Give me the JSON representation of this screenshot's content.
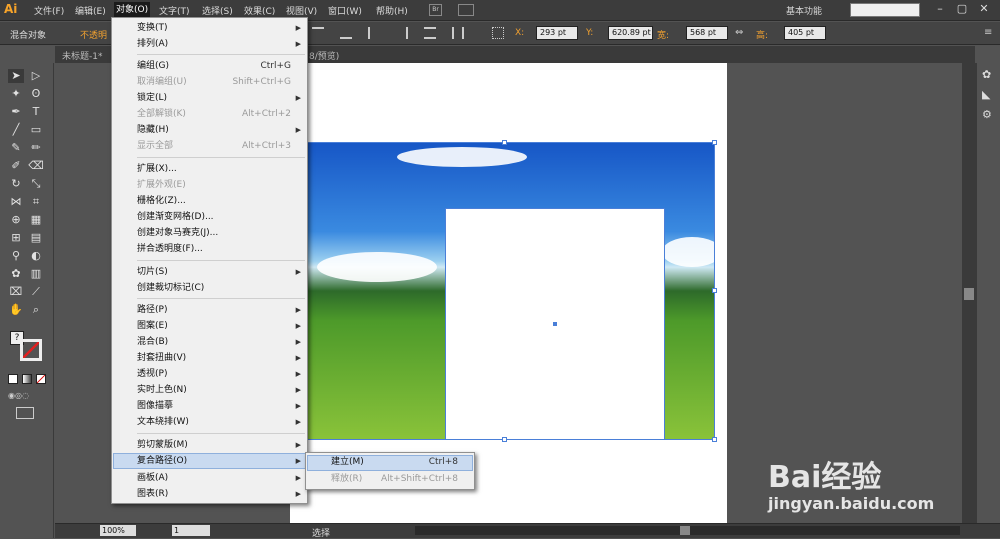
{
  "app": {
    "logo": "Ai"
  },
  "menubar": {
    "items": [
      "文件(F)",
      "编辑(E)",
      "对象(O)",
      "文字(T)",
      "选择(S)",
      "效果(C)",
      "视图(V)",
      "窗口(W)",
      "帮助(H)"
    ],
    "br": "Br",
    "workspace": "基本功能",
    "window_buttons": [
      "–",
      "▢",
      "✕"
    ]
  },
  "control": {
    "label": "混合对象",
    "opacity": "不透明",
    "x_label": "X:",
    "x": "293 pt",
    "y_label": "Y:",
    "y": "620.89 pt",
    "w_label": "宽:",
    "w": "568 pt",
    "h_label": "高:",
    "h": "405 pt"
  },
  "tabs": {
    "doc1": "未标题-1*",
    "doc2": "8/预览)"
  },
  "status": {
    "zoom": "100%",
    "page": "1",
    "mode": "选择"
  },
  "object_menu": {
    "items": [
      {
        "label": "变换(T)",
        "shortcut": "",
        "sub": true,
        "disabled": false
      },
      {
        "label": "排列(A)",
        "shortcut": "",
        "sub": true,
        "disabled": false
      },
      {
        "label": "编组(G)",
        "shortcut": "Ctrl+G",
        "sub": false,
        "disabled": false
      },
      {
        "label": "取消编组(U)",
        "shortcut": "Shift+Ctrl+G",
        "sub": false,
        "disabled": true
      },
      {
        "label": "锁定(L)",
        "shortcut": "",
        "sub": true,
        "disabled": false
      },
      {
        "label": "全部解锁(K)",
        "shortcut": "Alt+Ctrl+2",
        "sub": false,
        "disabled": true
      },
      {
        "label": "隐藏(H)",
        "shortcut": "",
        "sub": true,
        "disabled": false
      },
      {
        "label": "显示全部",
        "shortcut": "Alt+Ctrl+3",
        "sub": false,
        "disabled": true
      },
      {
        "label": "扩展(X)...",
        "shortcut": "",
        "sub": false,
        "disabled": false
      },
      {
        "label": "扩展外观(E)",
        "shortcut": "",
        "sub": false,
        "disabled": true
      },
      {
        "label": "栅格化(Z)...",
        "shortcut": "",
        "sub": false,
        "disabled": false
      },
      {
        "label": "创建渐变网格(D)...",
        "shortcut": "",
        "sub": false,
        "disabled": false
      },
      {
        "label": "创建对象马赛克(J)...",
        "shortcut": "",
        "sub": false,
        "disabled": false
      },
      {
        "label": "拼合透明度(F)...",
        "shortcut": "",
        "sub": false,
        "disabled": false
      },
      {
        "label": "切片(S)",
        "shortcut": "",
        "sub": true,
        "disabled": false
      },
      {
        "label": "创建裁切标记(C)",
        "shortcut": "",
        "sub": false,
        "disabled": false
      },
      {
        "label": "路径(P)",
        "shortcut": "",
        "sub": true,
        "disabled": false
      },
      {
        "label": "图案(E)",
        "shortcut": "",
        "sub": true,
        "disabled": false
      },
      {
        "label": "混合(B)",
        "shortcut": "",
        "sub": true,
        "disabled": false
      },
      {
        "label": "封套扭曲(V)",
        "shortcut": "",
        "sub": true,
        "disabled": false
      },
      {
        "label": "透视(P)",
        "shortcut": "",
        "sub": true,
        "disabled": false
      },
      {
        "label": "实时上色(N)",
        "shortcut": "",
        "sub": true,
        "disabled": false
      },
      {
        "label": "图像描摹",
        "shortcut": "",
        "sub": true,
        "disabled": false
      },
      {
        "label": "文本绕排(W)",
        "shortcut": "",
        "sub": true,
        "disabled": false
      },
      {
        "label": "剪切蒙版(M)",
        "shortcut": "",
        "sub": true,
        "disabled": false
      },
      {
        "label": "复合路径(O)",
        "shortcut": "",
        "sub": true,
        "disabled": false
      },
      {
        "label": "画板(A)",
        "shortcut": "",
        "sub": true,
        "disabled": false
      },
      {
        "label": "图表(R)",
        "shortcut": "",
        "sub": true,
        "disabled": false
      }
    ]
  },
  "compound_submenu": {
    "make_label": "建立(M)",
    "make_shortcut": "Ctrl+8",
    "release_label": "释放(R)",
    "release_shortcut": "Alt+Shift+Ctrl+8"
  },
  "watermark": {
    "text": "Bai经验",
    "url": "jingyan.baidu.com"
  },
  "colors": {
    "accent": "#f0a030",
    "highlight": "#c9daf0",
    "selection": "#4a7fd8"
  }
}
